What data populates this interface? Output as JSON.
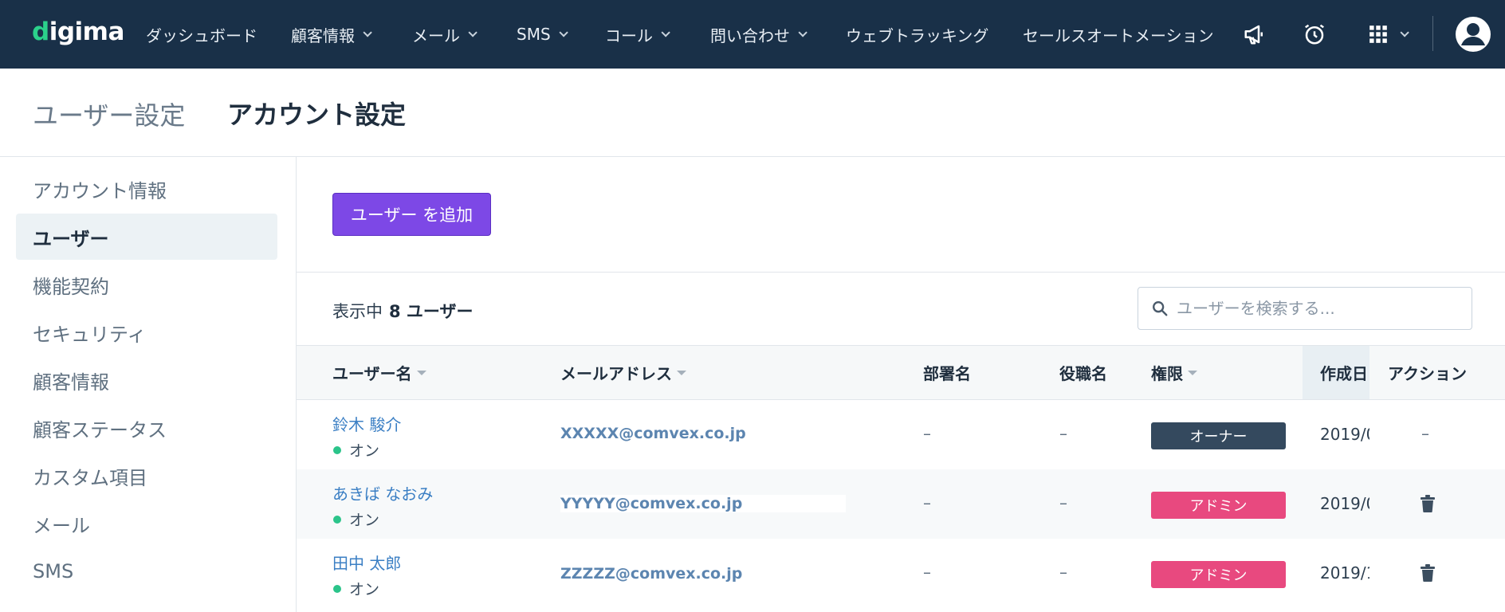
{
  "nav": {
    "logo": "digima",
    "items": [
      {
        "label": "ダッシュボード",
        "chevron": false
      },
      {
        "label": "顧客情報",
        "chevron": true
      },
      {
        "label": "メール",
        "chevron": true
      },
      {
        "label": "SMS",
        "chevron": true
      },
      {
        "label": "コール",
        "chevron": true
      },
      {
        "label": "問い合わせ",
        "chevron": true
      },
      {
        "label": "ウェブトラッキング",
        "chevron": false
      },
      {
        "label": "セールスオートメーション",
        "chevron": false
      }
    ],
    "icons": [
      "megaphone-icon",
      "alarm-clock-icon",
      "apps-grid-icon",
      "avatar-icon"
    ]
  },
  "header": {
    "breadcrumb_parent": "ユーザー設定",
    "title": "アカウント設定"
  },
  "sidebar": {
    "items": [
      {
        "label": "アカウント情報",
        "active": false
      },
      {
        "label": "ユーザー",
        "active": true
      },
      {
        "label": "機能契約",
        "active": false
      },
      {
        "label": "セキュリティ",
        "active": false
      },
      {
        "label": "顧客情報",
        "active": false
      },
      {
        "label": "顧客ステータス",
        "active": false
      },
      {
        "label": "カスタム項目",
        "active": false
      },
      {
        "label": "メール",
        "active": false
      },
      {
        "label": "SMS",
        "active": false
      }
    ]
  },
  "main": {
    "add_button": "ユーザー を追加",
    "count_label": "表示中",
    "count_value": "8 ユーザー",
    "search_placeholder": "ユーザーを検索する..."
  },
  "table": {
    "headers": {
      "name": "ユーザー名",
      "email": "メールアドレス",
      "dept": "部署名",
      "position": "役職名",
      "role": "権限",
      "created": "作成日",
      "action": "アクション"
    },
    "rows": [
      {
        "name": "鈴木 駿介",
        "status": "オン",
        "email": "XXXXX@comvex.co.jp",
        "dept": "–",
        "position": "–",
        "role": "オーナー",
        "role_type": "owner",
        "created": "2019/0",
        "action": "–"
      },
      {
        "name": "あきば なおみ",
        "status": "オン",
        "email": "YYYYY@comvex.co.jp",
        "dept": "–",
        "position": "–",
        "role": "アドミン",
        "role_type": "admin",
        "created": "2019/0",
        "action": "trash-icon"
      },
      {
        "name": "田中 太郎",
        "status": "オン",
        "email": "ZZZZZ@comvex.co.jp",
        "dept": "–",
        "position": "–",
        "role": "アドミン",
        "role_type": "admin",
        "created": "2019/1",
        "action": "trash-icon"
      }
    ]
  },
  "colors": {
    "nav_bg": "#193048",
    "accent_purple": "#7d48e6",
    "owner_badge": "#34495e",
    "admin_badge": "#e8497f",
    "status_on": "#2bc48a",
    "logo_green": "#2bd18b"
  }
}
